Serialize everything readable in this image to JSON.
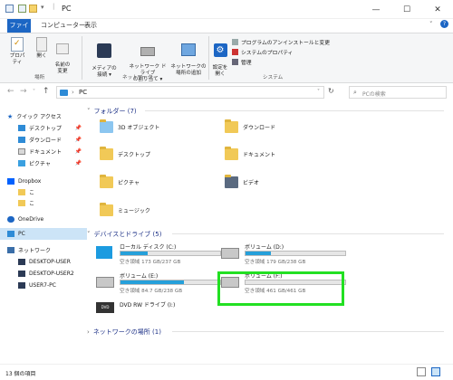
{
  "window": {
    "title": "PC"
  },
  "tabs": [
    "ファイル",
    "コンピューター",
    "表示"
  ],
  "ribbon": {
    "group1": {
      "buttons": [
        "プロパティ",
        "開く",
        "名前の\n変更"
      ],
      "label": "場所"
    },
    "group2": {
      "buttons": [
        "メディアの\n接続 ▾",
        "ネットワーク ドライブ\nの割り当て ▾",
        "ネットワークの\n場所の追加"
      ],
      "label": "ネットワーク"
    },
    "group3": {
      "button": "設定を\n開く",
      "items": [
        "プログラムのアンインストールと変更",
        "システムのプロパティ",
        "管理"
      ],
      "label": "システム"
    }
  },
  "address": {
    "path": "PC",
    "search_placeholder": "PCの検索"
  },
  "nav": {
    "quick_access": "クイック アクセス",
    "items": [
      "デスクトップ",
      "ダウンロード",
      "ドキュメント",
      "ピクチャ"
    ],
    "dropbox": "Dropbox",
    "dropbox_sub": [
      "こ",
      "こ"
    ],
    "onedrive": "OneDrive",
    "pc": "PC",
    "network": "ネットワーク",
    "network_items": [
      "DESKTOP-USER",
      "DESKTOP-USER2",
      "USER7-PC"
    ]
  },
  "folders": {
    "header": "フォルダー (7)",
    "items": [
      "3D オブジェクト",
      "ダウンロード",
      "デスクトップ",
      "ドキュメント",
      "ピクチャ",
      "ビデオ",
      "ミュージック"
    ]
  },
  "drives": {
    "header": "デバイスとドライブ (5)",
    "items": [
      {
        "name": "ローカル ディスク (C:)",
        "free": "空き領域 173 GB/237 GB",
        "used_fraction": 0.27
      },
      {
        "name": "ボリューム (D:)",
        "free": "空き領域 179 GB/238 GB",
        "used_fraction": 0.25
      },
      {
        "name": "ボリューム (E:)",
        "free": "空き領域 84.7 GB/238 GB",
        "used_fraction": 0.64
      },
      {
        "name": "ボリューム (F:)",
        "free": "空き領域 461 GB/461 GB",
        "used_fraction": 0.0
      },
      {
        "name": "DVD RW ドライブ (I:)"
      }
    ]
  },
  "network": {
    "header": "ネットワークの場所 (1)"
  },
  "status": {
    "count": "13 個の項目"
  },
  "colors": {
    "accent": "#1c66c4",
    "selection": "#cce4f7",
    "highlight": "#22e022",
    "usage_bar": "#26a0da"
  }
}
